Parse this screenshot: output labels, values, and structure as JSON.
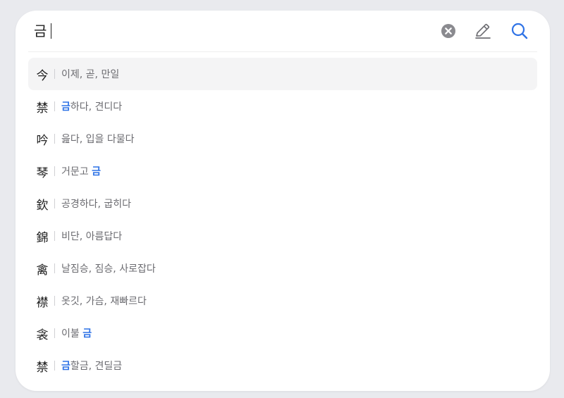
{
  "search": {
    "value": "금",
    "clear_icon": "clear-circle-x-icon",
    "pen_icon": "pen-handwriting-icon",
    "search_icon": "magnifier-icon"
  },
  "colors": {
    "highlight": "#2f73e6",
    "icon_gray": "#8a8a8f",
    "search_icon": "#2f73e6",
    "active_row_bg": "#f4f4f5"
  },
  "results": [
    {
      "hanja": "今",
      "parts": [
        {
          "t": "이제, 곧, 만일",
          "hl": false
        }
      ],
      "active": true
    },
    {
      "hanja": "禁",
      "parts": [
        {
          "t": "금",
          "hl": true
        },
        {
          "t": "하다, 견디다",
          "hl": false
        }
      ]
    },
    {
      "hanja": "吟",
      "parts": [
        {
          "t": "읊다, 입을 다물다",
          "hl": false
        }
      ]
    },
    {
      "hanja": "琴",
      "parts": [
        {
          "t": "거문고 ",
          "hl": false
        },
        {
          "t": "금",
          "hl": true
        }
      ]
    },
    {
      "hanja": "欽",
      "parts": [
        {
          "t": "공경하다, 굽히다",
          "hl": false
        }
      ]
    },
    {
      "hanja": "錦",
      "parts": [
        {
          "t": "비단, 아름답다",
          "hl": false
        }
      ]
    },
    {
      "hanja": "禽",
      "parts": [
        {
          "t": "날짐승, 짐승, 사로잡다",
          "hl": false
        }
      ]
    },
    {
      "hanja": "襟",
      "parts": [
        {
          "t": "옷깃, 가슴, 재빠르다",
          "hl": false
        }
      ]
    },
    {
      "hanja": "衾",
      "parts": [
        {
          "t": "이불 ",
          "hl": false
        },
        {
          "t": "금",
          "hl": true
        }
      ]
    },
    {
      "hanja": "禁",
      "parts": [
        {
          "t": "금",
          "hl": true
        },
        {
          "t": "할금, 견딜금",
          "hl": false
        }
      ]
    }
  ]
}
